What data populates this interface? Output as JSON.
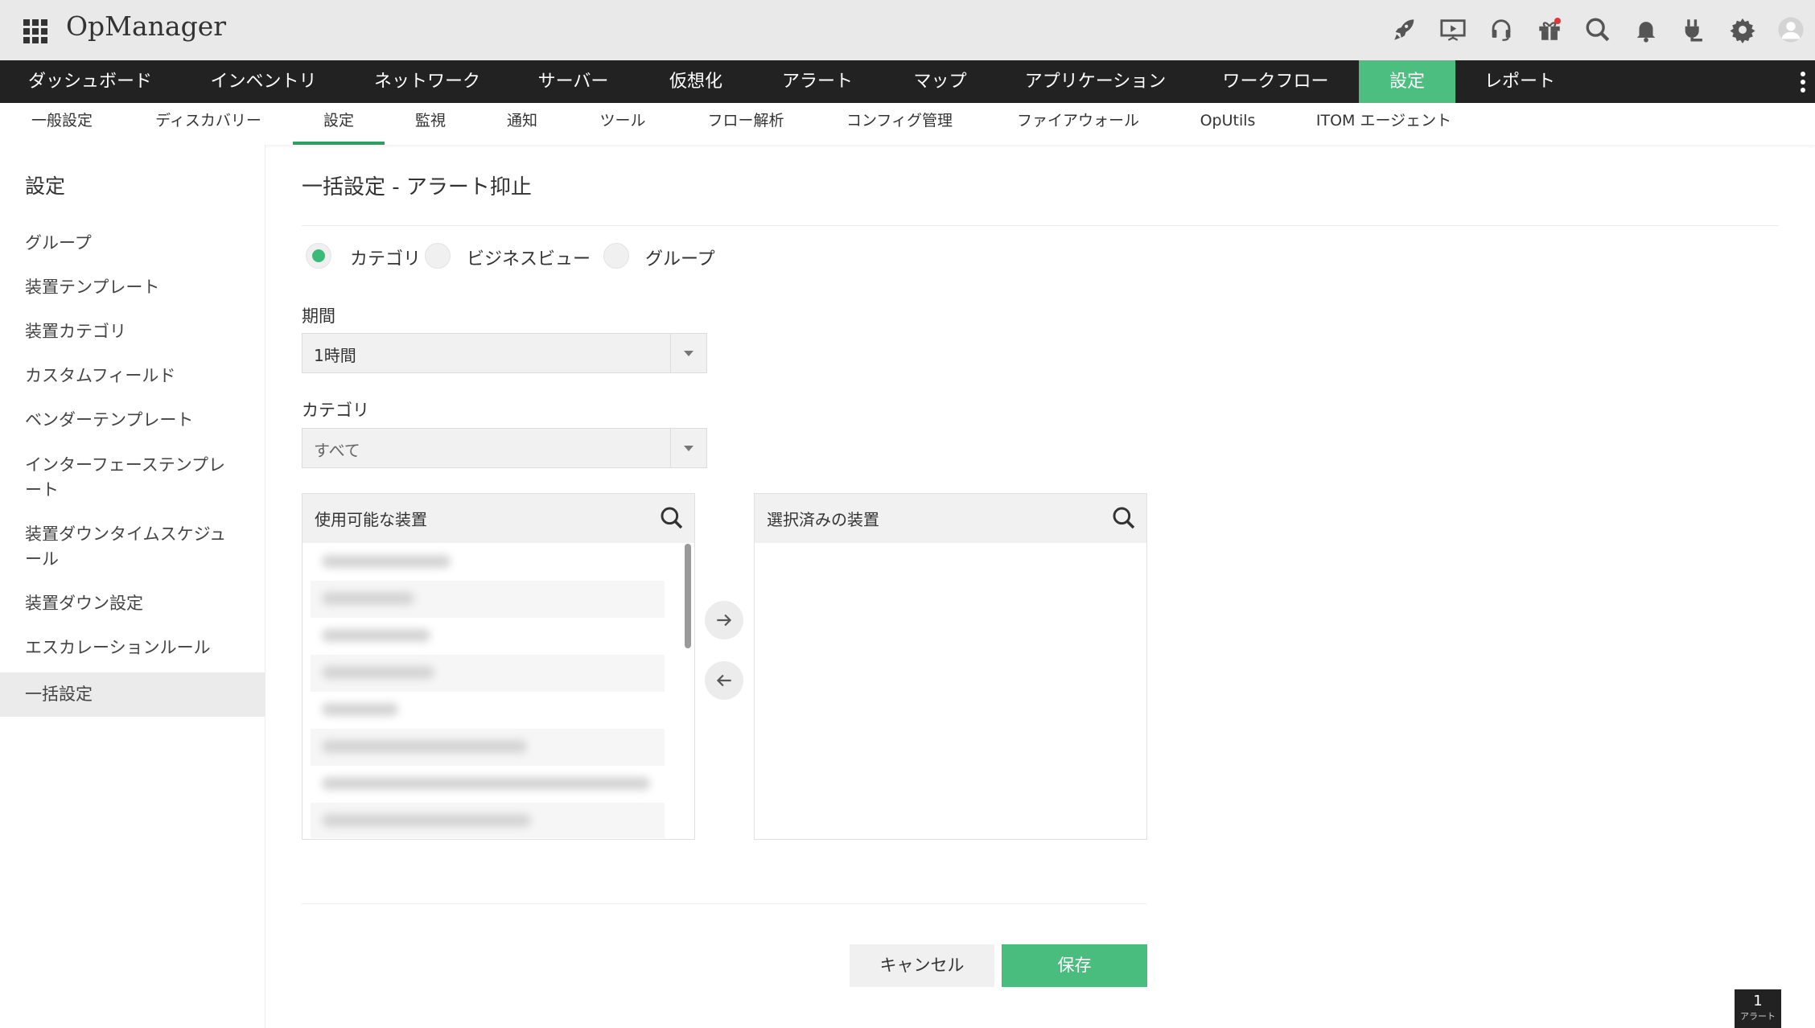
{
  "app": {
    "title": "OpManager"
  },
  "colors": {
    "accent": "#4cbf80",
    "nav_bg": "#222222",
    "header_bg": "#e9e9ea",
    "save": "#48bd7e"
  },
  "header_icons": [
    "rocket-icon",
    "presentation-icon",
    "headset-icon",
    "gift-icon",
    "search-icon",
    "bell-icon",
    "plug-icon",
    "gear-icon",
    "user-avatar-icon"
  ],
  "main_nav": {
    "items": [
      {
        "label": "ダッシュボード"
      },
      {
        "label": "インベントリ"
      },
      {
        "label": "ネットワーク"
      },
      {
        "label": "サーバー"
      },
      {
        "label": "仮想化"
      },
      {
        "label": "アラート"
      },
      {
        "label": "マップ"
      },
      {
        "label": "アプリケーション"
      },
      {
        "label": "ワークフロー"
      },
      {
        "label": "設定"
      },
      {
        "label": "レポート"
      }
    ],
    "active": "設定"
  },
  "sub_nav": {
    "items": [
      {
        "label": "一般設定"
      },
      {
        "label": "ディスカバリー"
      },
      {
        "label": "設定"
      },
      {
        "label": "監視"
      },
      {
        "label": "通知"
      },
      {
        "label": "ツール"
      },
      {
        "label": "フロー解析"
      },
      {
        "label": "コンフィグ管理"
      },
      {
        "label": "ファイアウォール"
      },
      {
        "label": "OpUtils"
      },
      {
        "label": "ITOM エージェント"
      }
    ],
    "active": "設定"
  },
  "sidebar": {
    "title": "設定",
    "items": [
      {
        "label": "グループ"
      },
      {
        "label": "装置テンプレート"
      },
      {
        "label": "装置カテゴリ"
      },
      {
        "label": "カスタムフィールド"
      },
      {
        "label": "ベンダーテンプレート"
      },
      {
        "label": "インターフェーステンプレート"
      },
      {
        "label": "装置ダウンタイムスケジュール"
      },
      {
        "label": "装置ダウン設定"
      },
      {
        "label": "エスカレーションルール"
      },
      {
        "label": "一括設定"
      }
    ],
    "active": "一括設定"
  },
  "page": {
    "title": "一括設定 - アラート抑止",
    "radios": [
      {
        "label": "カテゴリ",
        "checked": true
      },
      {
        "label": "ビジネスビュー",
        "checked": false
      },
      {
        "label": "グループ",
        "checked": false
      }
    ],
    "period": {
      "label": "期間",
      "value": "1時間"
    },
    "category": {
      "label": "カテゴリ",
      "value": "すべて"
    },
    "available": {
      "title": "使用可能な装置",
      "row_count": 9
    },
    "selected": {
      "title": "選択済みの装置"
    },
    "cancel_label": "キャンセル",
    "save_label": "保存"
  },
  "alert_badge": {
    "count": "1",
    "label": "アラート"
  }
}
